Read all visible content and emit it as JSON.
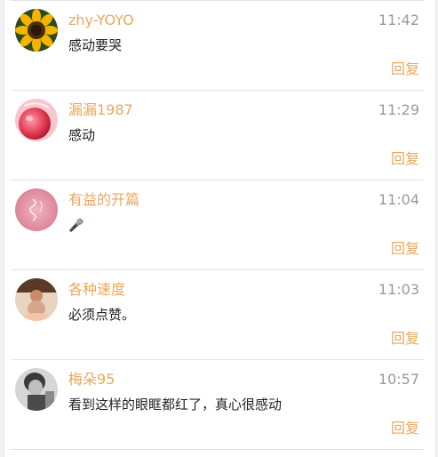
{
  "comments": [
    {
      "username": "zhy-YOYO",
      "time": "11:42",
      "content": "感动要哭",
      "reply_label": "回复",
      "avatar_icon": "sunflower-avatar"
    },
    {
      "username": "漏漏1987",
      "time": "11:29",
      "content": "感动",
      "reply_label": "回复",
      "avatar_icon": "red-fruit-avatar"
    },
    {
      "username": "有益的开篇",
      "time": "11:04",
      "content": "🎤",
      "reply_label": "回复",
      "avatar_icon": "pink-pattern-avatar"
    },
    {
      "username": "各种速度",
      "time": "11:03",
      "content": "必须点赞。",
      "reply_label": "回复",
      "avatar_icon": "figure-photo-avatar"
    },
    {
      "username": "梅朵95",
      "time": "10:57",
      "content": "看到这样的眼眶都红了，真心很感动",
      "reply_label": "回复",
      "avatar_icon": "portrait-photo-avatar"
    }
  ],
  "colors": {
    "accent": "#e9a85c",
    "time": "#9a9a9a",
    "text": "#222222",
    "divider": "#e3e3e3"
  }
}
